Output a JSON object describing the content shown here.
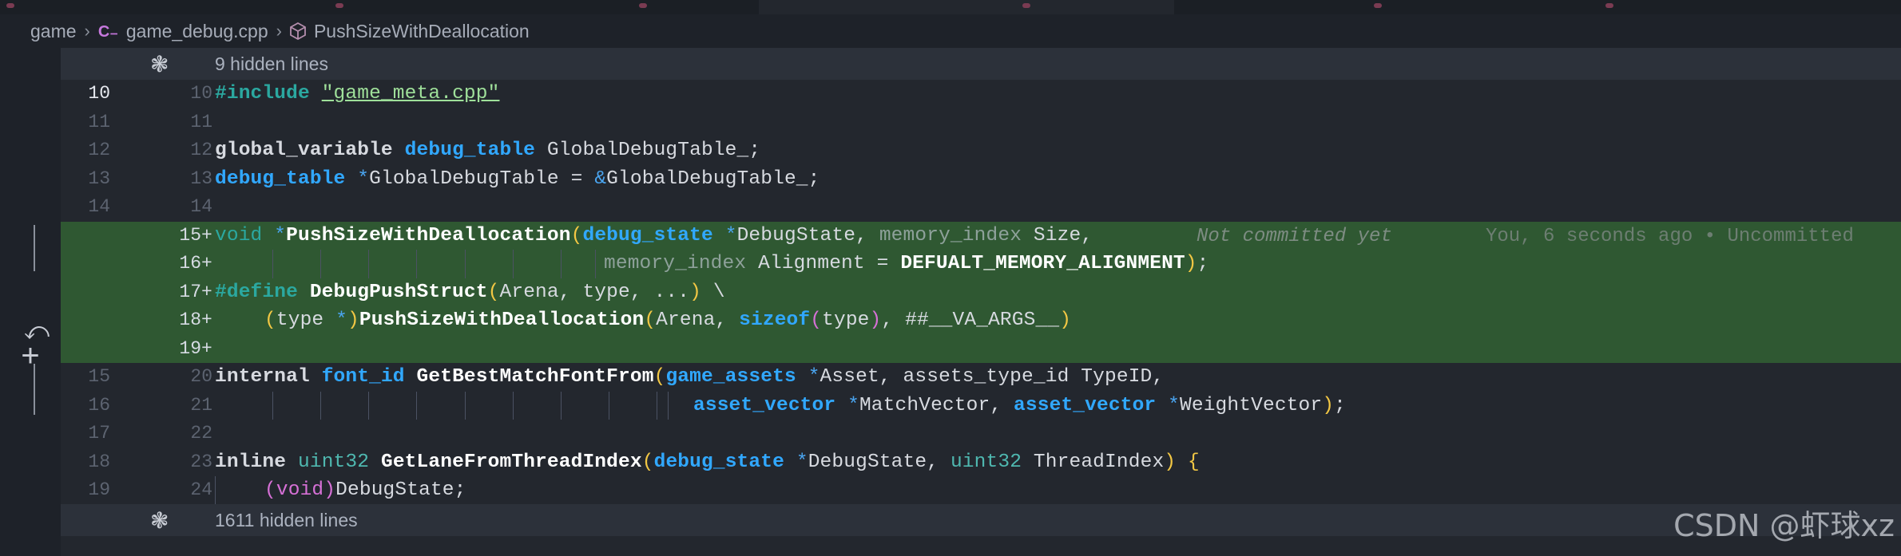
{
  "breadcrumb": {
    "folder": "game",
    "file": "game_debug.cpp",
    "symbol": "PushSizeWithDeallocation"
  },
  "folds": {
    "top": "9 hidden lines",
    "bottom": "1611 hidden lines"
  },
  "blame": {
    "status": "Not committed yet",
    "info": "You, 6 seconds ago • Uncommitted"
  },
  "lines": {
    "l1": {
      "old": "10",
      "new": "10"
    },
    "l2": {
      "old": "11",
      "new": "11"
    },
    "l3": {
      "old": "12",
      "new": "12"
    },
    "l4": {
      "old": "13",
      "new": "13"
    },
    "l5": {
      "old": "14",
      "new": "14"
    },
    "l6": {
      "old": "",
      "new": "15"
    },
    "l7": {
      "old": "",
      "new": "16"
    },
    "l8": {
      "old": "",
      "new": "17"
    },
    "l9": {
      "old": "",
      "new": "18"
    },
    "l10": {
      "old": "",
      "new": "19"
    },
    "l11": {
      "old": "15",
      "new": "20"
    },
    "l12": {
      "old": "16",
      "new": "21"
    },
    "l13": {
      "old": "17",
      "new": "22"
    },
    "l14": {
      "old": "18",
      "new": "23"
    },
    "l15": {
      "old": "19",
      "new": "24"
    }
  },
  "plus": "+",
  "tokens": {
    "l1": [
      "#include",
      " ",
      "\"game_meta.cpp\""
    ],
    "l3": [
      "global_variable",
      " ",
      "debug_table",
      " GlobalDebugTable_;"
    ],
    "l4": [
      "debug_table",
      " ",
      "*",
      "GlobalDebugTable = ",
      "&",
      "GlobalDebugTable_;"
    ],
    "l6": [
      "void",
      " ",
      "*",
      "PushSizeWithDeallocation",
      "(",
      "debug_state",
      " ",
      "*",
      "DebugState, ",
      "memory_index",
      " Size,"
    ],
    "l7": [
      "memory_index",
      " Alignment = ",
      "DEFUALT_MEMORY_ALIGNMENT",
      ")",
      ";"
    ],
    "l8": [
      "#define",
      " ",
      "DebugPushStruct",
      "(",
      "Arena, type, ...",
      ")",
      " \\"
    ],
    "l9": [
      "(",
      "type ",
      "*",
      ")",
      "PushSizeWithDeallocation",
      "(",
      "Arena, ",
      "sizeof",
      "(",
      "type",
      ")",
      ", ##__VA_ARGS__",
      ")"
    ],
    "l11": [
      "internal",
      " ",
      "font_id",
      " ",
      "GetBestMatchFontFrom",
      "(",
      "game_assets",
      " ",
      "*",
      "Asset, assets_type_id TypeID,"
    ],
    "l12": [
      "asset_vector",
      " ",
      "*",
      "MatchVector, ",
      "asset_vector",
      " ",
      "*",
      "WeightVector",
      ")",
      ";"
    ],
    "l14": [
      "inline",
      " ",
      "uint32",
      " ",
      "GetLaneFromThreadIndex",
      "(",
      "debug_state",
      " ",
      "*",
      "DebugState, ",
      "uint32",
      " ThreadIndex",
      ")",
      " ",
      "{"
    ],
    "l15": [
      "(",
      "void",
      ")",
      "DebugState;"
    ]
  },
  "watermark": "CSDN @虾球xz",
  "icons": {
    "cpp": "cpp-file-icon",
    "symbol": "cube-symbol-icon",
    "fold": "unfold-icon",
    "revert": "revert-change-icon",
    "stage": "add-change-icon"
  }
}
